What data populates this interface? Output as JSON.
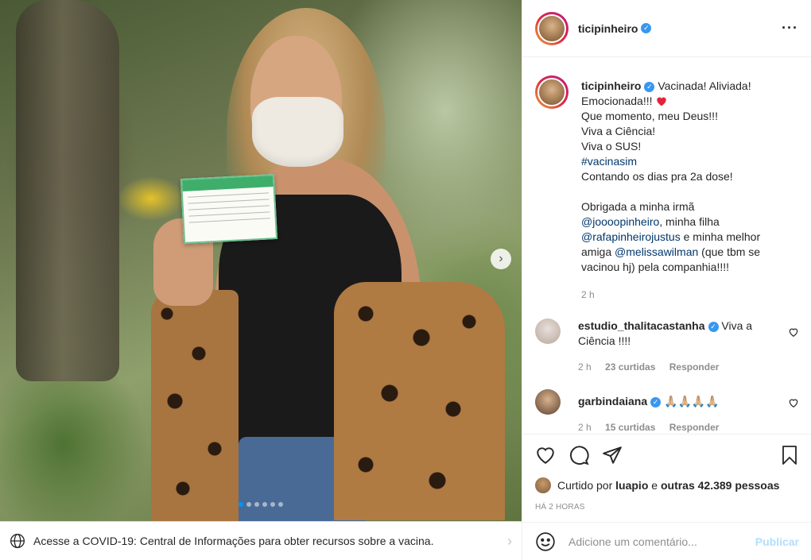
{
  "post": {
    "username": "ticipinheiro",
    "verified": true,
    "caption_lines": [
      "Vacinada! Aliviada!",
      "Emocionada!!!",
      "Que momento, meu Deus!!!",
      "Viva a Ciência!",
      "Viva o SUS!",
      "#vacinasim",
      "Contando os dias pra 2a dose!",
      "Obrigada a minha irmã",
      "@joooopinheiro",
      ", minha filha",
      "@rafapinheirojustus",
      " e minha melhor",
      "amiga ",
      "@melissawilman",
      " (que tbm se",
      "vacinou hj) pela companhia!!!!"
    ],
    "caption_time": "2 h",
    "carousel": {
      "total": 6,
      "active": 1
    }
  },
  "comments": [
    {
      "username": "estudio_thalitacastanha",
      "verified": true,
      "text": "Viva a Ciência !!!!",
      "time": "2 h",
      "likes": "23 curtidas",
      "reply": "Responder"
    },
    {
      "username": "garbindaiana",
      "verified": true,
      "text": "🙏🏼🙏🏼🙏🏼🙏🏼",
      "time": "2 h",
      "likes": "15 curtidas",
      "reply": "Responder"
    }
  ],
  "likes": {
    "prefix": "Curtido por",
    "user": "luapio",
    "middle": "e",
    "others": "outras 42.389 pessoas"
  },
  "timestamp": "Há 2 horas",
  "covid_notice": "Acesse a COVID-19: Central de Informações para obter recursos sobre a vacina.",
  "comment_input": {
    "placeholder": "Adicione um comentário...",
    "publish": "Publicar"
  },
  "icons": {
    "more": "more-icon",
    "like": "heart-icon",
    "comment": "comment-icon",
    "share": "share-icon",
    "save": "bookmark-icon",
    "emoji": "emoji-icon",
    "globe": "globe-icon",
    "next": "chevron-right-icon"
  },
  "colors": {
    "link": "#00376b",
    "verified": "#3897f0",
    "publish_disabled": "#b2dffc",
    "carousel_active": "#0095f6"
  }
}
